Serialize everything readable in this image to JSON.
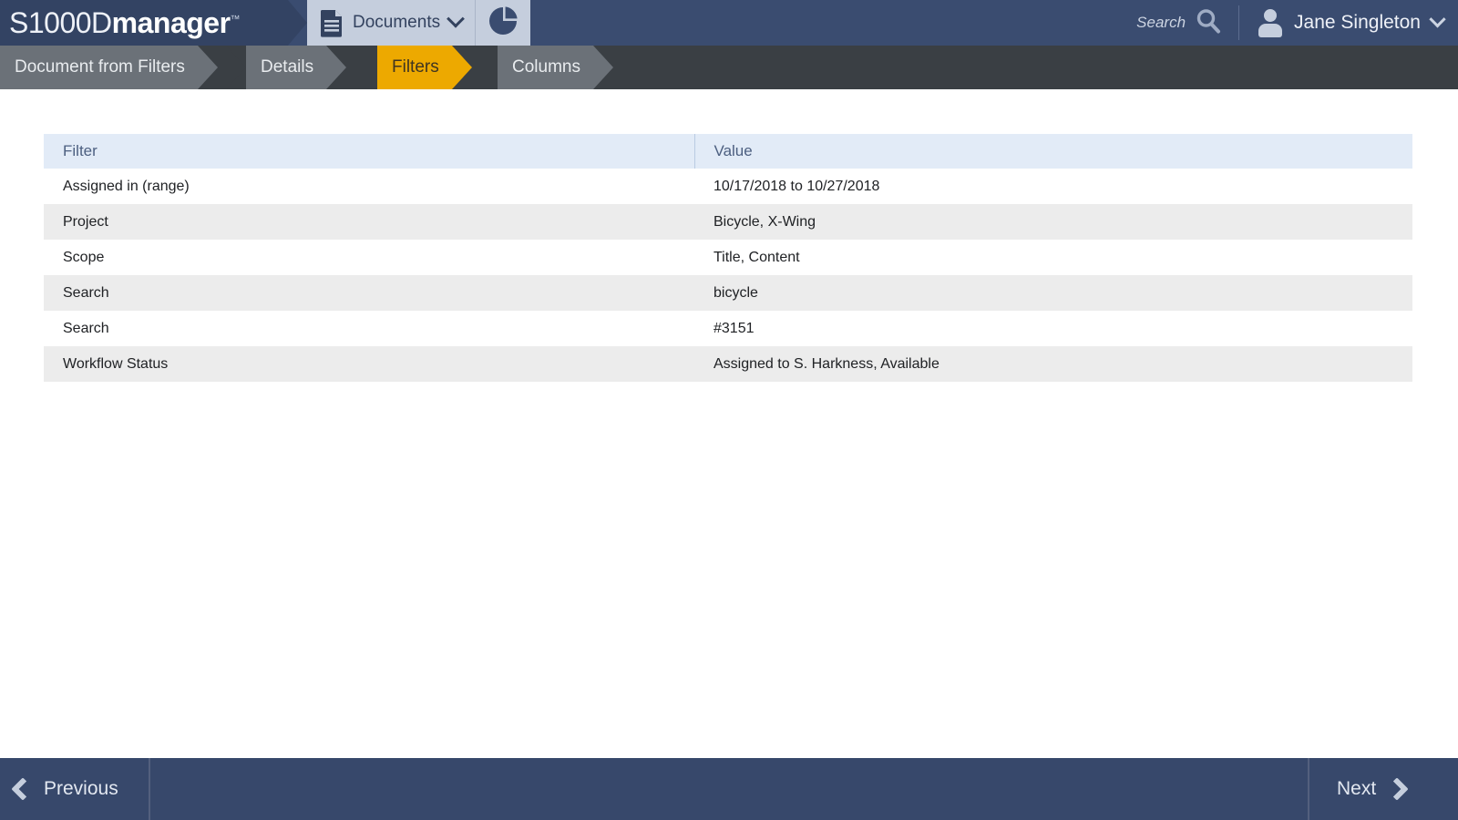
{
  "header": {
    "brand_thin": "S1000D",
    "brand_bold": "manager",
    "brand_tm": "™",
    "nav_documents_label": "Documents",
    "doc_icon": "document-icon",
    "chart_icon": "pie-chart-icon",
    "search_label": "Search",
    "search_icon": "search-icon",
    "user_name": "Jane Singleton",
    "user_icon": "user-avatar-icon",
    "user_chevron": "chevron-down-icon",
    "bg_color": "#3a4c70",
    "nav_bg_color": "#c5cedd"
  },
  "breadcrumb": {
    "bar_color": "#3a3f44",
    "active_color": "#eda900",
    "inactive_color": "#6b7178",
    "steps": [
      {
        "label": "Document from Filters",
        "active": false
      },
      {
        "label": "Details",
        "active": false
      },
      {
        "label": "Filters",
        "active": true
      },
      {
        "label": "Columns",
        "active": false
      }
    ]
  },
  "table": {
    "columns": [
      "Filter",
      "Value"
    ],
    "header_bg": "#e2ebf7",
    "header_text_color": "#4c5f80",
    "rows": [
      {
        "filter": "Assigned in (range)",
        "value": "10/17/2018 to 10/27/2018"
      },
      {
        "filter": "Project",
        "value": "Bicycle, X-Wing"
      },
      {
        "filter": "Scope",
        "value": "Title, Content"
      },
      {
        "filter": "Search",
        "value": "bicycle"
      },
      {
        "filter": "Search",
        "value": "#3151"
      },
      {
        "filter": "Workflow Status",
        "value": "Assigned to S. Harkness, Available"
      }
    ]
  },
  "footer": {
    "previous_label": "Previous",
    "next_label": "Next",
    "previous_icon": "chevron-left-icon",
    "next_icon": "chevron-right-icon",
    "bg_color": "#37486b"
  }
}
